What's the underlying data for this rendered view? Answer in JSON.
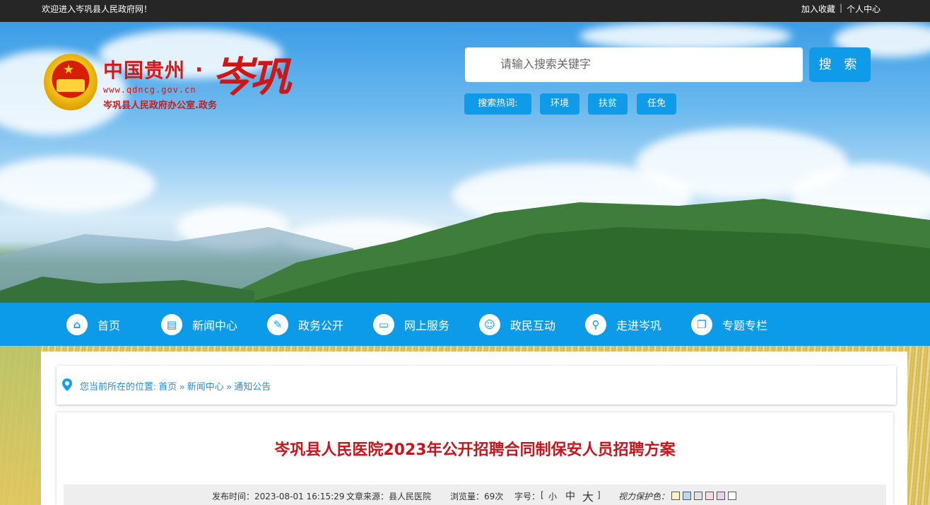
{
  "topbar": {
    "welcome": "欢迎进入岑巩县人民政府网！",
    "bookmark": "加入收藏",
    "separator": "|",
    "personal_center": "个人中心"
  },
  "logo": {
    "title": "中国贵州",
    "dot": ".",
    "calligraphy": "岑巩",
    "url": "www.qdncg.gov.cn",
    "office": "岑巩县人民政府办公室.政务"
  },
  "search": {
    "placeholder": "请输入搜索关键字",
    "button": "搜 索",
    "hot_label": "搜索热词:",
    "hot_words": [
      "环境",
      "扶贫",
      "任免"
    ]
  },
  "nav": {
    "items": [
      {
        "label": "首页",
        "icon": "home-icon"
      },
      {
        "label": "新闻中心",
        "icon": "newspaper-icon"
      },
      {
        "label": "政务公开",
        "icon": "pen-icon"
      },
      {
        "label": "网上服务",
        "icon": "monitor-icon"
      },
      {
        "label": "政民互动",
        "icon": "people-icon"
      },
      {
        "label": "走进岑巩",
        "icon": "map-icon"
      },
      {
        "label": "专题专栏",
        "icon": "bookmark-icon"
      }
    ]
  },
  "breadcrumb": {
    "prefix": "您当前所在的位置:",
    "home": "首页",
    "sep1": "»",
    "news": "新闻中心",
    "sep2": "»",
    "notice": "通知公告"
  },
  "article": {
    "title": "岑巩县人民医院2023年公开招聘合同制保安人员招聘方案",
    "publish_time": "发布时间：2023-08-01 16:15:29",
    "source": "文章来源：县人民医院",
    "views": "浏览量：69次",
    "font_size_label": "字号：",
    "bracket_open": "[",
    "font_small": "小",
    "font_medium": "中",
    "font_large": "大",
    "bracket_close": "]",
    "eye_care_label": "视力保护色：",
    "eye_colors": [
      "#fbf3c4",
      "#b7d9f3",
      "#e3e3e3",
      "#f8dde0",
      "#e6d3ef",
      "#ffffff"
    ]
  },
  "colors": {
    "nav_blue": "#0c9be9",
    "title_red": "#c8141b",
    "link_blue": "#2a8bd6"
  }
}
